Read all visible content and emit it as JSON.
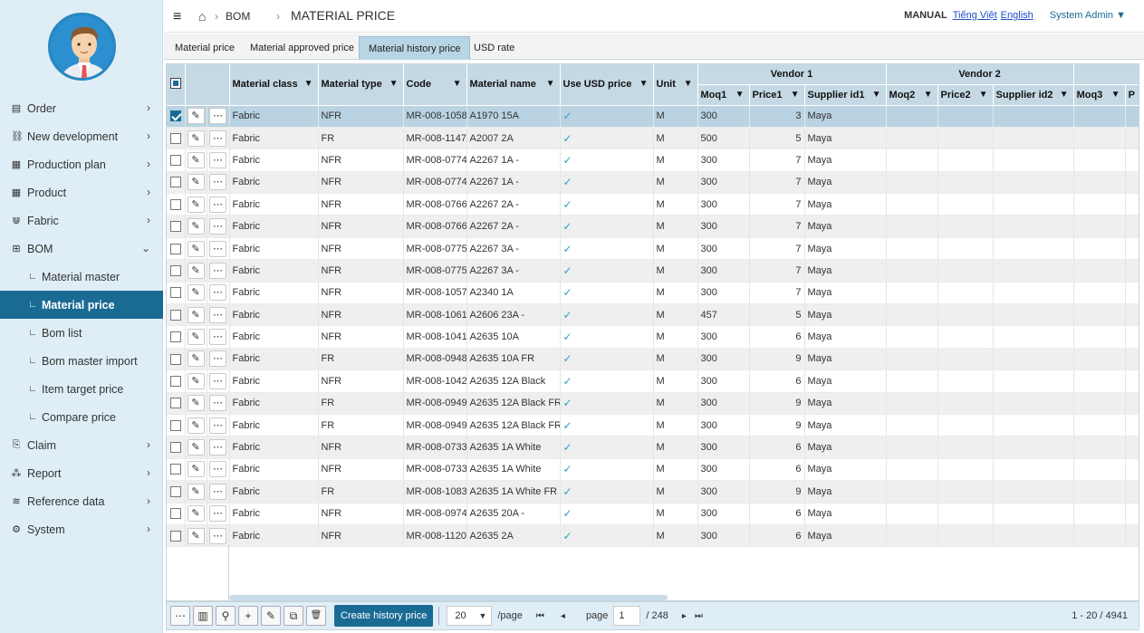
{
  "sidebar": {
    "items": [
      {
        "label": "Order",
        "icon": "document-icon",
        "glyph": "▤",
        "chev": "›",
        "sub": false
      },
      {
        "label": "New development",
        "icon": "link-icon",
        "glyph": "⛓",
        "chev": "›",
        "sub": false
      },
      {
        "label": "Production plan",
        "icon": "grid-icon",
        "glyph": "▦",
        "chev": "›",
        "sub": false
      },
      {
        "label": "Product",
        "icon": "grid-icon",
        "glyph": "▦",
        "chev": "›",
        "sub": false
      },
      {
        "label": "Fabric",
        "icon": "magnet-icon",
        "glyph": "⋓",
        "chev": "›",
        "sub": false
      },
      {
        "label": "BOM",
        "icon": "table-icon",
        "glyph": "⊞",
        "chev": "⌄",
        "sub": false
      },
      {
        "label": "Material master",
        "icon": "sub-item-icon",
        "glyph": "∟",
        "chev": "",
        "sub": true
      },
      {
        "label": "Material price",
        "icon": "sub-item-icon",
        "glyph": "∟",
        "chev": "",
        "sub": true,
        "active": true
      },
      {
        "label": "Bom list",
        "icon": "sub-item-icon",
        "glyph": "∟",
        "chev": "",
        "sub": true
      },
      {
        "label": "Bom master import",
        "icon": "sub-item-icon",
        "glyph": "∟",
        "chev": "",
        "sub": true
      },
      {
        "label": "Item target price",
        "icon": "sub-item-icon",
        "glyph": "∟",
        "chev": "",
        "sub": true
      },
      {
        "label": "Compare price",
        "icon": "sub-item-icon",
        "glyph": "∟",
        "chev": "",
        "sub": true
      },
      {
        "label": "Claim",
        "icon": "claim-icon",
        "glyph": "⎘",
        "chev": "›",
        "sub": false
      },
      {
        "label": "Report",
        "icon": "sitemap-icon",
        "glyph": "⁂",
        "chev": "›",
        "sub": false
      },
      {
        "label": "Reference data",
        "icon": "database-icon",
        "glyph": "≋",
        "chev": "›",
        "sub": false
      },
      {
        "label": "System",
        "icon": "gear-icon",
        "glyph": "⚙",
        "chev": "›",
        "sub": false
      }
    ]
  },
  "header": {
    "menu_glyph": "≡",
    "home_glyph": "⌂",
    "sep": "›",
    "breadcrumb_parent": "BOM",
    "page_title": "MATERIAL PRICE",
    "manual": "MANUAL",
    "lang_vi": "Tiếng Việt",
    "lang_en": "English",
    "user": "System Admin ▼"
  },
  "tabs": [
    "Material price",
    "Material approved price",
    "Material history price",
    "USD rate"
  ],
  "grid": {
    "group_headers": {
      "vendor1": "Vendor 1",
      "vendor2": "Vendor 2"
    },
    "columns": {
      "material_class": "Material class",
      "material_type": "Material type",
      "code": "Code",
      "material_name": "Material name",
      "use_usd": "Use USD price",
      "unit": "Unit",
      "moq1": "Moq1",
      "price1": "Price1",
      "supplier1": "Supplier id1",
      "moq2": "Moq2",
      "price2": "Price2",
      "supplier2": "Supplier id2",
      "moq3": "Moq3",
      "p3": "P"
    },
    "filter_glyph": "▼",
    "edit_glyph": "✎",
    "more_glyph": "⋯",
    "check_glyph": "✓",
    "rows": [
      {
        "checked": true,
        "cls": "Fabric",
        "type": "NFR",
        "code": "MR-008-1058",
        "name": "A1970 15A",
        "unit": "M",
        "moq1": "300",
        "price1": "3",
        "supplier1": "Maya"
      },
      {
        "checked": false,
        "cls": "Fabric",
        "type": "FR",
        "code": "MR-008-1147",
        "name": "A2007 2A",
        "unit": "M",
        "moq1": "500",
        "price1": "5",
        "supplier1": "Maya"
      },
      {
        "checked": false,
        "cls": "Fabric",
        "type": "NFR",
        "code": "MR-008-0774",
        "name": "A2267 1A -",
        "unit": "M",
        "moq1": "300",
        "price1": "7",
        "supplier1": "Maya"
      },
      {
        "checked": false,
        "cls": "Fabric",
        "type": "NFR",
        "code": "MR-008-0774",
        "name": "A2267 1A -",
        "unit": "M",
        "moq1": "300",
        "price1": "7",
        "supplier1": "Maya"
      },
      {
        "checked": false,
        "cls": "Fabric",
        "type": "NFR",
        "code": "MR-008-0766",
        "name": "A2267 2A -",
        "unit": "M",
        "moq1": "300",
        "price1": "7",
        "supplier1": "Maya"
      },
      {
        "checked": false,
        "cls": "Fabric",
        "type": "NFR",
        "code": "MR-008-0766",
        "name": "A2267 2A -",
        "unit": "M",
        "moq1": "300",
        "price1": "7",
        "supplier1": "Maya"
      },
      {
        "checked": false,
        "cls": "Fabric",
        "type": "NFR",
        "code": "MR-008-0775",
        "name": "A2267 3A -",
        "unit": "M",
        "moq1": "300",
        "price1": "7",
        "supplier1": "Maya"
      },
      {
        "checked": false,
        "cls": "Fabric",
        "type": "NFR",
        "code": "MR-008-0775",
        "name": "A2267 3A -",
        "unit": "M",
        "moq1": "300",
        "price1": "7",
        "supplier1": "Maya"
      },
      {
        "checked": false,
        "cls": "Fabric",
        "type": "NFR",
        "code": "MR-008-1057",
        "name": "A2340 1A",
        "unit": "M",
        "moq1": "300",
        "price1": "7",
        "supplier1": "Maya"
      },
      {
        "checked": false,
        "cls": "Fabric",
        "type": "NFR",
        "code": "MR-008-1061",
        "name": "A2606 23A -",
        "unit": "M",
        "moq1": "457",
        "price1": "5",
        "supplier1": "Maya"
      },
      {
        "checked": false,
        "cls": "Fabric",
        "type": "NFR",
        "code": "MR-008-1041",
        "name": "A2635 10A",
        "unit": "M",
        "moq1": "300",
        "price1": "6",
        "supplier1": "Maya"
      },
      {
        "checked": false,
        "cls": "Fabric",
        "type": "FR",
        "code": "MR-008-0948",
        "name": "A2635 10A FR",
        "unit": "M",
        "moq1": "300",
        "price1": "9",
        "supplier1": "Maya"
      },
      {
        "checked": false,
        "cls": "Fabric",
        "type": "NFR",
        "code": "MR-008-1042",
        "name": "A2635 12A Black",
        "unit": "M",
        "moq1": "300",
        "price1": "6",
        "supplier1": "Maya"
      },
      {
        "checked": false,
        "cls": "Fabric",
        "type": "FR",
        "code": "MR-008-0949",
        "name": "A2635 12A Black FR",
        "unit": "M",
        "moq1": "300",
        "price1": "9",
        "supplier1": "Maya"
      },
      {
        "checked": false,
        "cls": "Fabric",
        "type": "FR",
        "code": "MR-008-0949",
        "name": "A2635 12A Black FR",
        "unit": "M",
        "moq1": "300",
        "price1": "9",
        "supplier1": "Maya"
      },
      {
        "checked": false,
        "cls": "Fabric",
        "type": "NFR",
        "code": "MR-008-0733",
        "name": "A2635 1A White",
        "unit": "M",
        "moq1": "300",
        "price1": "6",
        "supplier1": "Maya"
      },
      {
        "checked": false,
        "cls": "Fabric",
        "type": "NFR",
        "code": "MR-008-0733",
        "name": "A2635 1A White",
        "unit": "M",
        "moq1": "300",
        "price1": "6",
        "supplier1": "Maya"
      },
      {
        "checked": false,
        "cls": "Fabric",
        "type": "FR",
        "code": "MR-008-1083",
        "name": "A2635 1A White FR",
        "unit": "M",
        "moq1": "300",
        "price1": "9",
        "supplier1": "Maya"
      },
      {
        "checked": false,
        "cls": "Fabric",
        "type": "NFR",
        "code": "MR-008-0974",
        "name": "A2635 20A -",
        "unit": "M",
        "moq1": "300",
        "price1": "6",
        "supplier1": "Maya"
      },
      {
        "checked": false,
        "cls": "Fabric",
        "type": "NFR",
        "code": "MR-008-1120",
        "name": "A2635 2A",
        "unit": "M",
        "moq1": "300",
        "price1": "6",
        "supplier1": "Maya"
      }
    ]
  },
  "footer": {
    "more_glyph": "⋯",
    "columns_glyph": "▥",
    "search_glyph": "⚲",
    "add_glyph": "+",
    "edit_glyph": "✎",
    "copy_glyph": "⧉",
    "delete_glyph": "🗑",
    "create_label": "Create history price",
    "page_size": "20",
    "per_page": "/page",
    "first_glyph": "⏮",
    "prev_glyph": "◂",
    "next_glyph": "▸",
    "last_glyph": "⏭",
    "page_label": "page",
    "page_value": "1",
    "total_pages": "/ 248",
    "range": "1 - 20 / 4941"
  },
  "colors": {
    "accent": "#1a6b94",
    "sidebar_bg": "#dfeef6",
    "header_bg": "#c5d9e4",
    "selected_row": "#b9d3e2",
    "check": "#2aa1c9"
  }
}
